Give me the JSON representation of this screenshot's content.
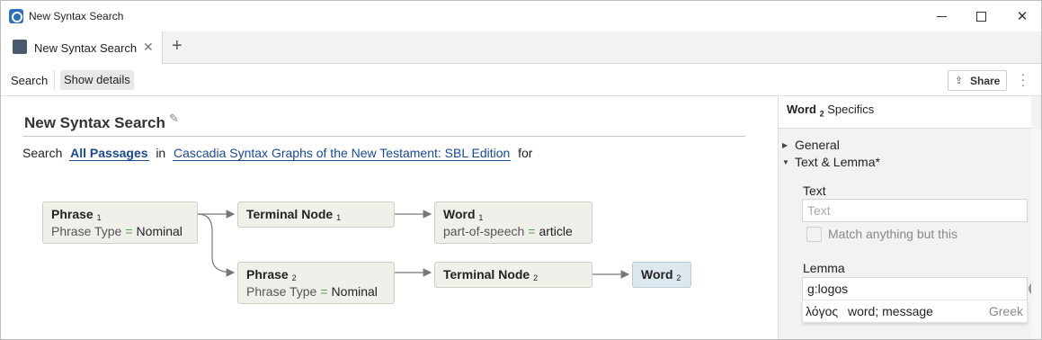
{
  "window": {
    "title": "New Syntax Search"
  },
  "tabs": [
    {
      "label": "New Syntax Search",
      "close": "✕"
    }
  ],
  "tab_add": "+",
  "toolbar": {
    "search_label": "Search",
    "details_label": "Show details",
    "share_label": "Share"
  },
  "main": {
    "title": "New Syntax Search",
    "search_prefix": "Search",
    "scope": "All Passages",
    "in_word": "in",
    "resource": "Cascadia Syntax Graphs of the New Testament: SBL Edition",
    "for_word": "for"
  },
  "graph": {
    "nodes": [
      {
        "name": "Phrase",
        "index": "1",
        "attr_key": "Phrase Type",
        "attr_op": "=",
        "attr_val": "Nominal"
      },
      {
        "name": "Terminal Node",
        "index": "1"
      },
      {
        "name": "Word",
        "index": "1",
        "attr_key": "part-of-speech",
        "attr_op": "=",
        "attr_val": "article"
      },
      {
        "name": "Phrase",
        "index": "2",
        "attr_key": "Phrase Type",
        "attr_op": "=",
        "attr_val": "Nominal"
      },
      {
        "name": "Terminal Node",
        "index": "2"
      },
      {
        "name": "Word",
        "index": "2"
      }
    ]
  },
  "side": {
    "title_bold": "Word",
    "title_index": "2",
    "title_rest": "Specifics",
    "sections": [
      {
        "label": "General",
        "expanded": false
      },
      {
        "label": "Text & Lemma*",
        "expanded": true
      }
    ],
    "text_label": "Text",
    "text_placeholder": "Text",
    "match_label": "Match anything but this",
    "lemma_label": "Lemma",
    "lemma_value": "g:logos",
    "suggestion": {
      "lemma": "λόγος",
      "gloss": "word; message",
      "language": "Greek"
    }
  },
  "colors": {
    "link": "#1a4a8c",
    "node_bg": "#f0f0ea",
    "target_node_bg": "#dde7ee",
    "operator": "#4ca44c"
  }
}
